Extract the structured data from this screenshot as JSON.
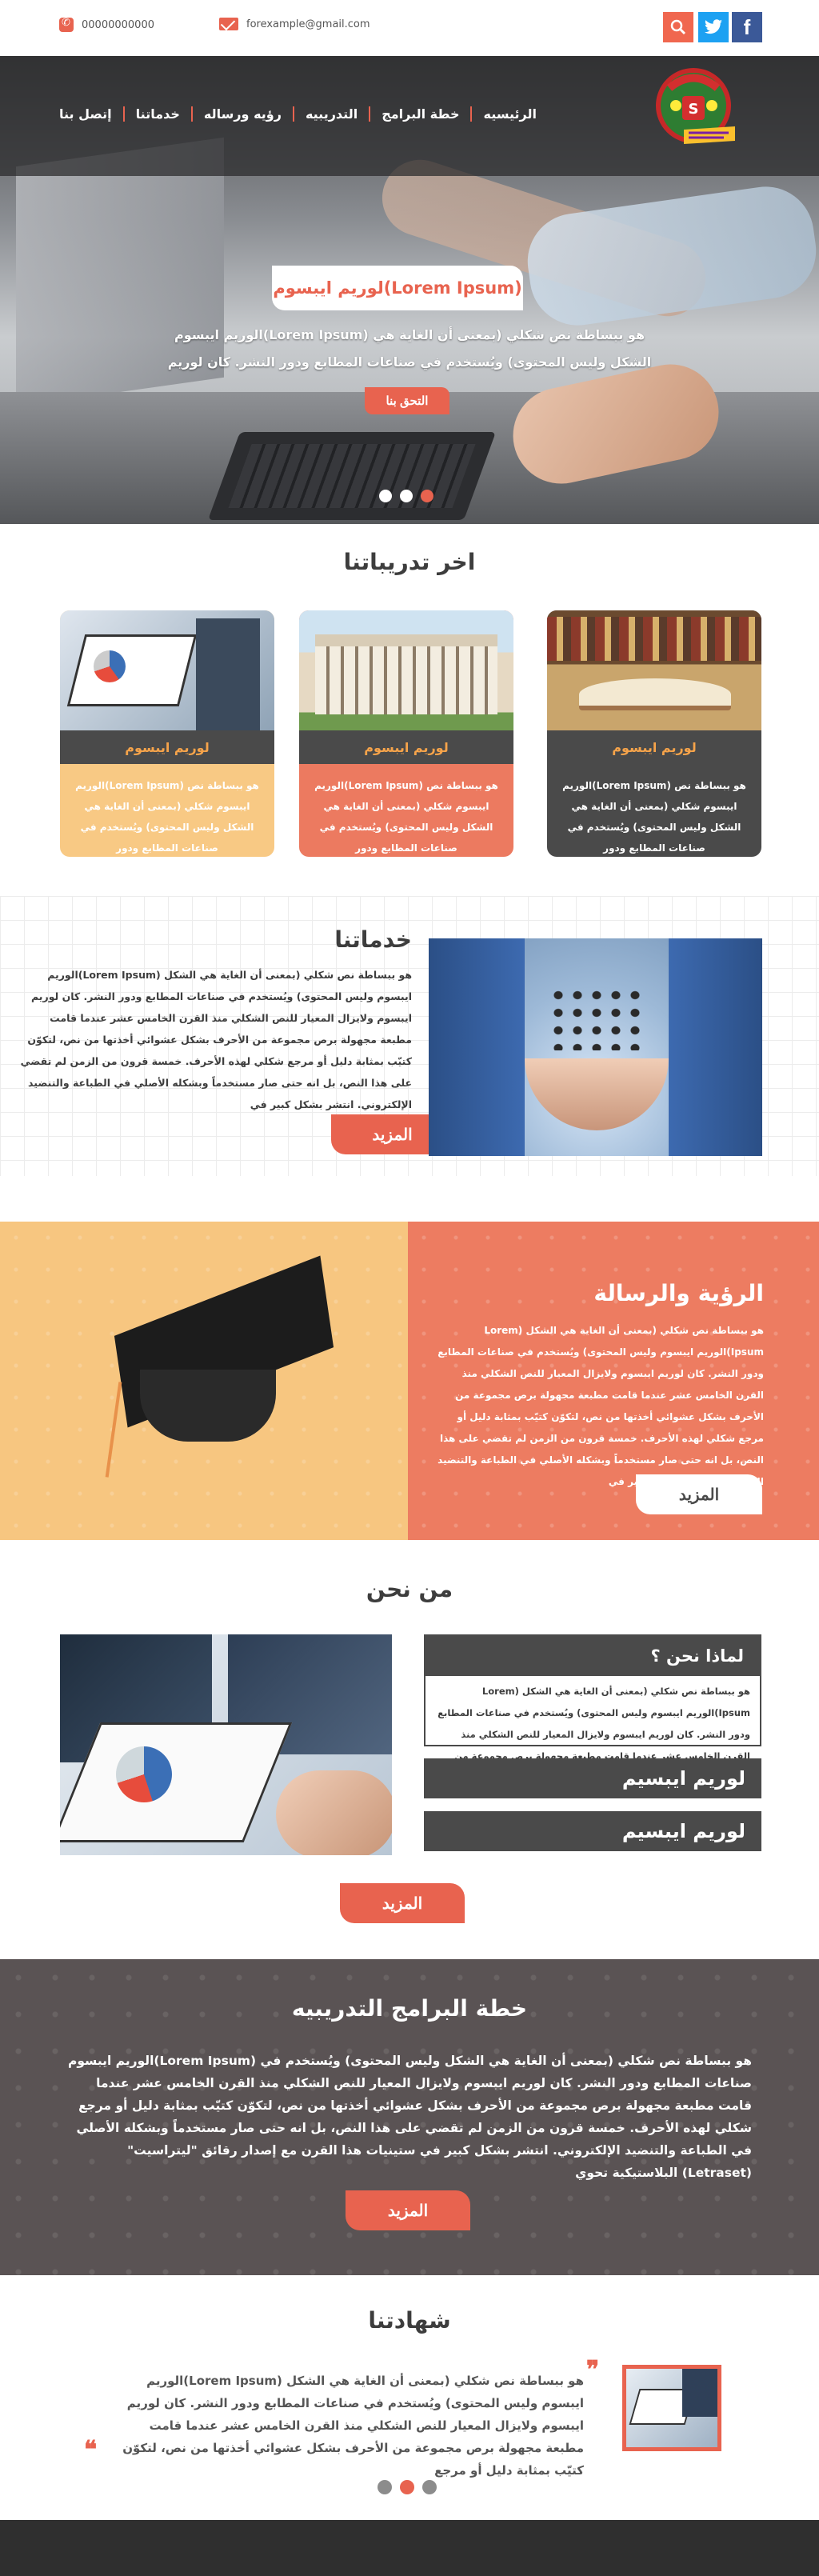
{
  "header": {
    "phone": "00000000000",
    "email": "forexample@gmail.com",
    "social": [
      "search-icon",
      "twitter-icon",
      "facebook-icon"
    ]
  },
  "nav": {
    "items": [
      "الرئيسيه",
      "خطة البرامج",
      "التدريبيه",
      "رؤيه ورساله",
      "خدماتنا",
      "إتصل بنا"
    ]
  },
  "hero": {
    "title": "لوريم ايبسوم(Lorem Ipsum)",
    "text": "هو ببساطة نص شكلي (بمعنى أن الغاية هي (Lorem Ipsum)الوريم ايبسوم الشكل وليس المحتوى) ويُستخدم في صناعات المطابع ودور النشر. كان لوريم",
    "button": "التحق بنا",
    "slide_count": 3,
    "active_slide": 3
  },
  "latest": {
    "title": "اخر تدريباتنا",
    "cards": [
      {
        "title": "لوريم ايبسوم",
        "text": "هو ببساطة نص (Lorem Ipsum)الوريم ايبسوم شكلي (بمعنى أن الغاية هي الشكل وليس المحتوى) ويُستخدم في صناعات المطابع ودور",
        "image": "laptop-chart-photo",
        "bg": "#f8c984",
        "fg": "#ffffff"
      },
      {
        "title": "لوريم ايبسوم",
        "text": "هو ببساطة نص (Lorem Ipsum)الوريم ايبسوم شكلي (بمعنى أن الغاية هي الشكل وليس المحتوى) ويُستخدم في صناعات المطابع ودور",
        "image": "university-building-photo",
        "bg": "#ec7a60",
        "fg": "#ffffff"
      },
      {
        "title": "لوريم ايبسوم",
        "text": "هو ببساطة نص (Lorem Ipsum)الوريم ايبسوم شكلي (بمعنى أن الغاية هي الشكل وليس المحتوى) ويُستخدم في صناعات المطابع ودور",
        "image": "books-photo",
        "bg": "#4a4a4a",
        "fg": "#ffffff"
      }
    ]
  },
  "services": {
    "title": "خدماتنا",
    "text": "هو ببساطة نص شكلي (بمعنى أن الغاية هي الشكل (Lorem Ipsum)الوريم ايبسوم وليس المحتوى) ويُستخدم في صناعات المطابع ودور النشر. كان لوريم ايبسوم ولايزال المعيار للنص الشكلي منذ القرن الخامس عشر عندما قامت مطبعة مجهولة برص مجموعة من الأحرف بشكل عشوائي أخذتها من نص، لتكوّن كتيّب بمثابة دليل أو مرجع شكلي لهذه الأحرف. خمسة قرون من الزمن لم تقضي على هذا النص، بل انه حتى صار مستخدماً وبشكله الأصلي في الطباعة والتنضيد الإلكتروني. انتشر بشكل كبير في",
    "button": "المزيد"
  },
  "vision": {
    "title": "الرؤية والرسالة",
    "text": "هو ببساطة نص شكلي (بمعنى أن الغاية هي الشكل (Lorem Ipsum)الوريم ايبسوم وليس المحتوى) ويُستخدم في صناعات المطابع ودور النشر. كان لوريم ايبسوم ولايزال المعيار للنص الشكلي منذ القرن الخامس عشر عندما قامت مطبعة مجهولة برص مجموعة من الأحرف بشكل عشوائي أخذتها من نص، لتكوّن كتيّب بمثابة دليل أو مرجع شكلي لهذه الأحرف. خمسة قرون من الزمن لم تقضي على هذا النص، بل انه حتى صار مستخدماً وبشكله الأصلي في الطباعة والتنضيد الإلكتروني. انتشر بشكل كبير في",
    "button": "المزيد"
  },
  "about": {
    "title": "من نحن",
    "why_title": "لماذا نحن ؟",
    "why_text": "هو ببساطة نص شكلي (بمعنى أن الغاية هي الشكل (Lorem Ipsum)الوريم ايبسوم وليس المحتوى) ويُستخدم في صناعات المطابع ودور النشر. كان لوريم ايبسوم ولايزال المعيار للنص الشكلي منذ القرن الخامس عشر عندما قامت مطبعة مجهولة برص مجموعة من الأحرف",
    "bars": [
      "لوريم ايبسيم",
      "لوريم ايبسيم"
    ],
    "button": "المزيد"
  },
  "training_plan": {
    "title": "خطة البرامج التدريبيه",
    "text": "هو ببساطة نص شكلي (بمعنى أن الغاية هي الشكل وليس المحتوى) ويُستخدم في (Lorem Ipsum)الوريم ايبسوم صناعات المطابع ودور النشر. كان لوريم ايبسوم ولايزال المعيار للنص الشكلي منذ القرن الخامس عشر عندما قامت مطبعة مجهولة برص مجموعة من الأحرف بشكل عشوائي أخذتها من نص، لتكوّن كتيّب بمثابة دليل أو مرجع شكلي لهذه الأحرف. خمسة قرون من الزمن لم تقضي على هذا النص، بل انه حتى صار مستخدماً وبشكله الأصلي في الطباعة والتنضيد الإلكتروني. انتشر بشكل كبير في ستينيات هذا القرن مع إصدار رقائق \"ليتراسيت\" (Letraset) البلاستيكية تحوي",
    "button": "المزيد"
  },
  "testimonials": {
    "title": "شهادتنا",
    "text": "هو ببساطة نص شكلي (بمعنى أن الغاية هي الشكل (Lorem Ipsum)الوريم ايبسوم وليس المحتوى) ويُستخدم في صناعات المطابع ودور النشر. كان لوريم ايبسوم ولايزال المعيار للنص الشكلي منذ القرن الخامس عشر عندما قامت مطبعة مجهولة برص مجموعة من الأحرف بشكل عشوائي أخذتها من نص، لتكوّن كتيّب بمثابة دليل أو مرجع",
    "slide_count": 3,
    "active_slide": 2
  },
  "colors": {
    "accent": "#e8634f",
    "dark": "#4a4a4a",
    "gold": "#f8c984",
    "salmon": "#ec7a60",
    "plum": "#5a5354"
  }
}
